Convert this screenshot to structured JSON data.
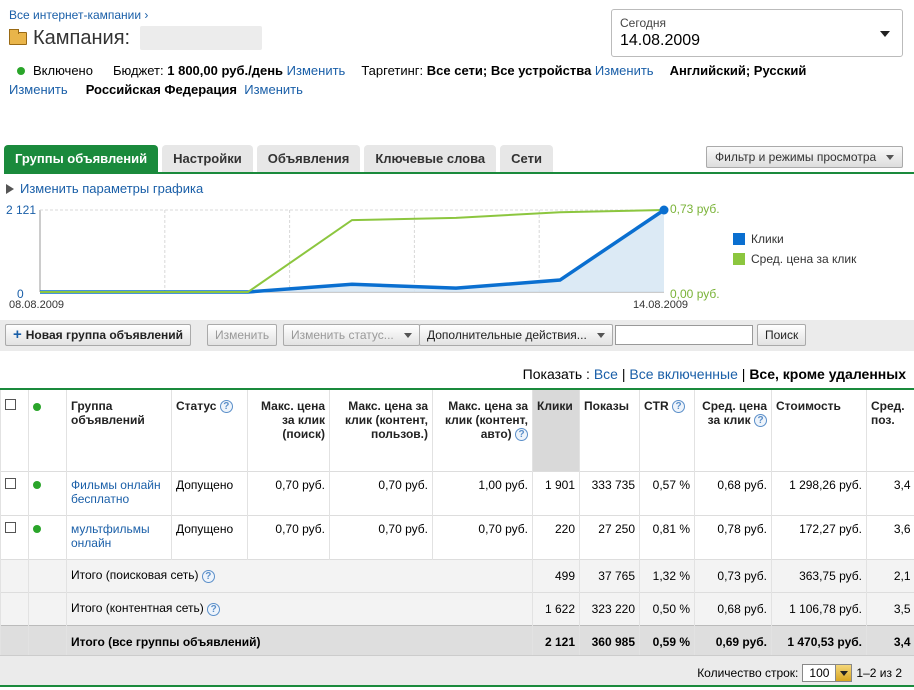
{
  "header": {
    "all_campaigns_link": "Все интернет-кампании ›",
    "campaign_prefix": "Кампания:",
    "date_label": "Сегодня",
    "date_value": "14.08.2009"
  },
  "info": {
    "status": "Включено",
    "budget_label": "Бюджет:",
    "budget_value": "1 800,00 руб./день",
    "change": "Изменить",
    "targeting_label": "Таргетинг:",
    "targeting_value": "Все сети; Все устройства",
    "languages": "Английский; Русский",
    "region": "Российская Федерация"
  },
  "tabs": [
    "Группы объявлений",
    "Настройки",
    "Объявления",
    "Ключевые слова",
    "Сети"
  ],
  "filter_button": "Фильтр и режимы просмотра",
  "graph_link": "Изменить параметры графика",
  "chart_data": {
    "type": "line",
    "x_start_label": "08.08.2009",
    "x_end_label": "14.08.2009",
    "y_left_ticks": [
      "2 121",
      "0"
    ],
    "y_right_ticks": [
      "0,73 руб.",
      "0,00 руб."
    ],
    "series": [
      {
        "name": "Клики",
        "color": "#0a6fd0",
        "values": [
          0,
          0,
          0,
          200,
          100,
          310,
          2121
        ],
        "area": true
      },
      {
        "name": "Сред. цена за клик",
        "color": "#8cc63f",
        "values": [
          0,
          0,
          0,
          0.64,
          0.66,
          0.71,
          0.73
        ]
      }
    ],
    "y_left_range": [
      0,
      2121
    ],
    "y_right_range": [
      0,
      0.73
    ]
  },
  "toolbar": {
    "new_group": "Новая группа объявлений",
    "edit": "Изменить",
    "edit_status": "Изменить статус...",
    "more_actions": "Дополнительные действия...",
    "search_button": "Поиск"
  },
  "show": {
    "label": "Показать :",
    "all": "Все",
    "all_enabled": "Все включенные",
    "all_but_deleted": "Все, кроме удаленных"
  },
  "table": {
    "columns": {
      "group": "Группа объявлений",
      "status": "Статус",
      "max_cpc_search": "Макс. цена за клик (поиск)",
      "max_cpc_content_user": "Макс. цена за клик (контент, пользов.)",
      "max_cpc_content_auto": "Макс. цена за клик (контент, авто)",
      "clicks": "Клики",
      "impressions": "Показы",
      "ctr": "CTR",
      "avg_cpc": "Сред. цена за клик",
      "cost": "Стоимость",
      "avg_pos": "Сред. поз."
    },
    "rows": [
      {
        "name": "Фильмы онлайн бесплатно",
        "status": "Допущено",
        "cpc_search": "0,70 руб.",
        "cpc_user": "0,70 руб.",
        "cpc_auto": "1,00 руб.",
        "clicks": "1 901",
        "impressions": "333 735",
        "ctr": "0,57 %",
        "avg_cpc": "0,68 руб.",
        "cost": "1 298,26 руб.",
        "pos": "3,4"
      },
      {
        "name": "мультфильмы онлайн",
        "status": "Допущено",
        "cpc_search": "0,70 руб.",
        "cpc_user": "0,70 руб.",
        "cpc_auto": "0,70 руб.",
        "clicks": "220",
        "impressions": "27 250",
        "ctr": "0,81 %",
        "avg_cpc": "0,78 руб.",
        "cost": "172,27 руб.",
        "pos": "3,6"
      }
    ],
    "summary": [
      {
        "label": "Итого (поисковая сеть)",
        "clicks": "499",
        "impressions": "37 765",
        "ctr": "1,32 %",
        "avg_cpc": "0,73 руб.",
        "cost": "363,75 руб.",
        "pos": "2,1"
      },
      {
        "label": "Итого (контентная сеть)",
        "clicks": "1 622",
        "impressions": "323 220",
        "ctr": "0,50 %",
        "avg_cpc": "0,68 руб.",
        "cost": "1 106,78 руб.",
        "pos": "3,5"
      }
    ],
    "total": {
      "label": "Итого (все группы объявлений)",
      "clicks": "2 121",
      "impressions": "360 985",
      "ctr": "0,59 %",
      "avg_cpc": "0,69 руб.",
      "cost": "1 470,53 руб.",
      "pos": "3,4"
    }
  },
  "footer": {
    "rows_label": "Количество строк:",
    "rows_value": "100",
    "range": "1–2 из 2"
  }
}
